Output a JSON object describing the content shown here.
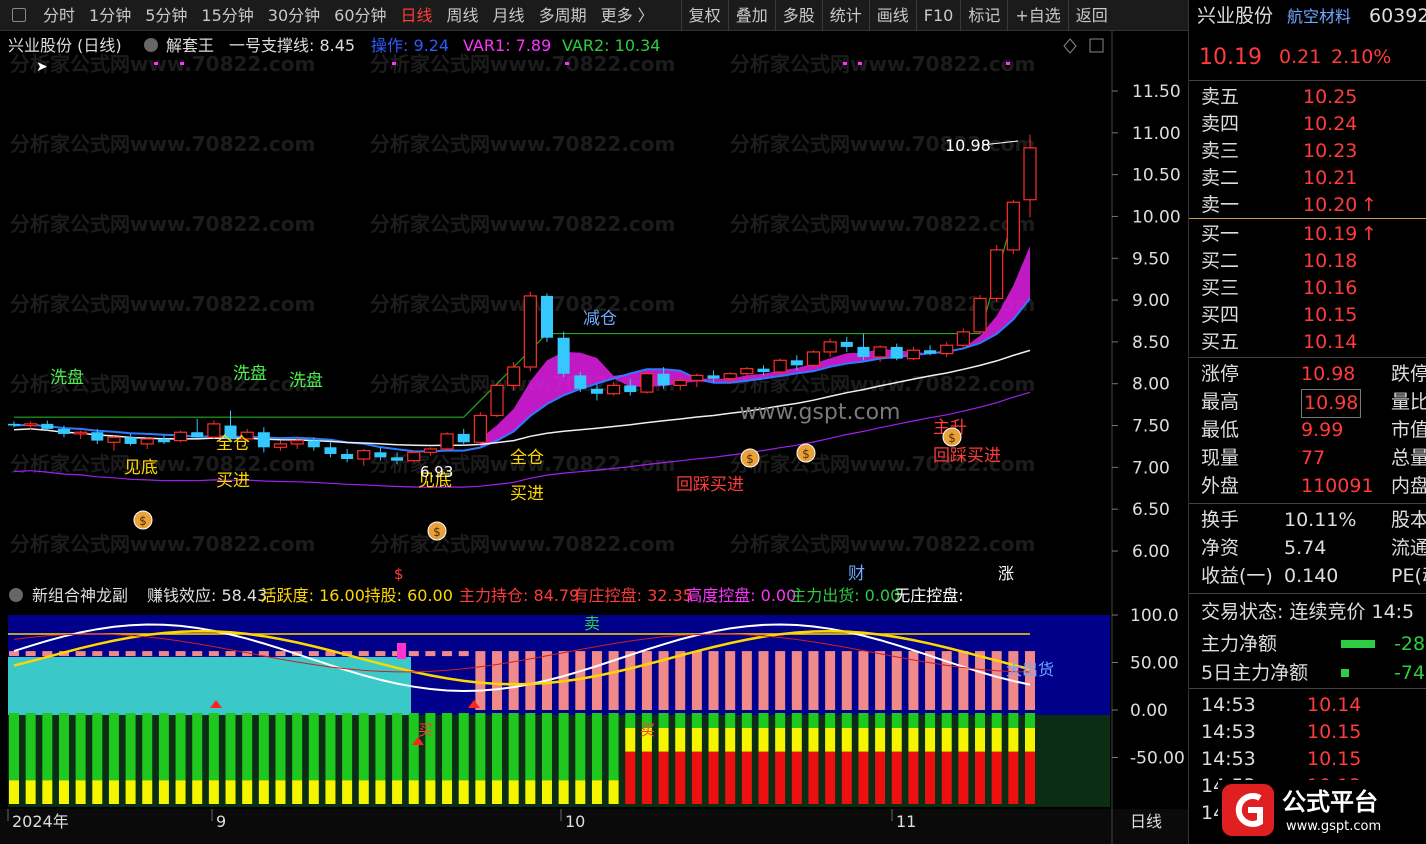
{
  "toolbar": {
    "items": [
      "分时",
      "1分钟",
      "5分钟",
      "15分钟",
      "30分钟",
      "60分钟",
      "日线",
      "周线",
      "月线",
      "多周期",
      "更多 〉"
    ],
    "active_index": 6,
    "right_items": [
      "复权",
      "叠加",
      "多股",
      "统计",
      "画线",
      "F10",
      "标记",
      "+自选",
      "返回"
    ]
  },
  "main_header": {
    "title": "兴业股份 (日线)",
    "indicator": "解套王",
    "support": "一号支撑线: 8.45",
    "op": "操作: 9.24",
    "var1": "VAR1: 7.89",
    "var2": "VAR2: 10.34"
  },
  "sub_header": {
    "name": "新组合神龙副",
    "items": [
      {
        "text": "赚钱效应: 58.43",
        "color": "#e0e0e0"
      },
      {
        "text": "活跃度: 16.00",
        "color": "#ffd700"
      },
      {
        "text": "持股: 60.00",
        "color": "#ffd700"
      },
      {
        "text": "主力持仓: 84.79",
        "color": "#ff3b3b"
      },
      {
        "text": "有庄控盘: 32.35",
        "color": "#ff3b3b"
      },
      {
        "text": "高度控盘: 0.00",
        "color": "#ff33ff"
      },
      {
        "text": "主力出货: 0.00",
        "color": "#2ecc40"
      },
      {
        "text": "无庄控盘:",
        "color": "#ffffff"
      }
    ]
  },
  "chart_data": {
    "type": "candlestick",
    "ylim": [
      6.0,
      11.5
    ],
    "yticks": [
      "11.50",
      "11.00",
      "10.50",
      "10.00",
      "9.50",
      "9.00",
      "8.50",
      "8.00",
      "7.50",
      "7.00",
      "6.50",
      "6.00"
    ],
    "x_labels": [
      "2024年",
      "9",
      "10",
      "11"
    ],
    "period_label": "日线",
    "candles": [
      [
        7.52,
        7.55,
        7.48,
        7.5
      ],
      [
        7.5,
        7.55,
        7.45,
        7.52
      ],
      [
        7.52,
        7.56,
        7.44,
        7.46
      ],
      [
        7.46,
        7.5,
        7.36,
        7.4
      ],
      [
        7.4,
        7.44,
        7.34,
        7.42
      ],
      [
        7.42,
        7.46,
        7.28,
        7.32
      ],
      [
        7.3,
        7.38,
        7.2,
        7.36
      ],
      [
        7.36,
        7.4,
        7.26,
        7.28
      ],
      [
        7.28,
        7.36,
        7.22,
        7.34
      ],
      [
        7.34,
        7.38,
        7.28,
        7.3
      ],
      [
        7.32,
        7.44,
        7.3,
        7.42
      ],
      [
        7.42,
        7.58,
        7.38,
        7.36
      ],
      [
        7.36,
        7.56,
        7.34,
        7.52
      ],
      [
        7.5,
        7.68,
        7.3,
        7.34
      ],
      [
        7.34,
        7.46,
        7.3,
        7.42
      ],
      [
        7.42,
        7.48,
        7.18,
        7.24
      ],
      [
        7.24,
        7.32,
        7.2,
        7.28
      ],
      [
        7.28,
        7.36,
        7.22,
        7.32
      ],
      [
        7.32,
        7.36,
        7.2,
        7.24
      ],
      [
        7.24,
        7.3,
        7.12,
        7.16
      ],
      [
        7.16,
        7.22,
        7.06,
        7.1
      ],
      [
        7.1,
        7.22,
        7.02,
        7.2
      ],
      [
        7.18,
        7.24,
        7.08,
        7.12
      ],
      [
        7.12,
        7.18,
        7.04,
        7.08
      ],
      [
        7.08,
        7.2,
        7.06,
        7.18
      ],
      [
        7.18,
        7.24,
        7.14,
        7.22
      ],
      [
        7.22,
        7.42,
        7.2,
        7.4
      ],
      [
        7.4,
        7.46,
        7.26,
        7.3
      ],
      [
        7.3,
        7.66,
        7.28,
        7.62
      ],
      [
        7.62,
        8.0,
        7.6,
        7.98
      ],
      [
        7.98,
        8.26,
        7.92,
        8.2
      ],
      [
        8.2,
        9.1,
        8.15,
        9.05
      ],
      [
        9.05,
        9.08,
        8.5,
        8.55
      ],
      [
        8.55,
        8.62,
        8.08,
        8.12
      ],
      [
        8.1,
        8.14,
        7.9,
        7.94
      ],
      [
        7.94,
        8.0,
        7.8,
        7.88
      ],
      [
        7.88,
        8.02,
        7.86,
        7.98
      ],
      [
        7.98,
        8.06,
        7.86,
        7.9
      ],
      [
        7.9,
        8.14,
        7.88,
        8.12
      ],
      [
        8.12,
        8.2,
        7.94,
        7.98
      ],
      [
        7.98,
        8.08,
        7.92,
        8.04
      ],
      [
        8.04,
        8.12,
        7.96,
        8.1
      ],
      [
        8.1,
        8.16,
        8.02,
        8.06
      ],
      [
        8.06,
        8.14,
        8.0,
        8.12
      ],
      [
        8.12,
        8.2,
        8.08,
        8.18
      ],
      [
        8.18,
        8.22,
        8.1,
        8.14
      ],
      [
        8.14,
        8.3,
        8.12,
        8.28
      ],
      [
        8.28,
        8.34,
        8.16,
        8.22
      ],
      [
        8.22,
        8.4,
        8.2,
        8.38
      ],
      [
        8.38,
        8.54,
        8.32,
        8.5
      ],
      [
        8.5,
        8.56,
        8.38,
        8.44
      ],
      [
        8.44,
        8.6,
        8.28,
        8.32
      ],
      [
        8.32,
        8.46,
        8.26,
        8.44
      ],
      [
        8.44,
        8.48,
        8.28,
        8.3
      ],
      [
        8.3,
        8.44,
        8.28,
        8.4
      ],
      [
        8.4,
        8.46,
        8.34,
        8.36
      ],
      [
        8.36,
        8.5,
        8.32,
        8.46
      ],
      [
        8.46,
        8.66,
        8.44,
        8.62
      ],
      [
        8.62,
        9.06,
        8.6,
        9.02
      ],
      [
        9.02,
        9.66,
        8.98,
        9.6
      ],
      [
        9.6,
        10.2,
        9.55,
        10.17
      ],
      [
        10.2,
        10.98,
        9.99,
        10.82
      ]
    ],
    "annotations": {
      "high_label": "10.98",
      "low_label": "6.93",
      "jiancang": "减仓",
      "xipan": "洗盘",
      "jiandi": "见底",
      "quancang": "全仓",
      "mairu": "买进",
      "huicai": "回踩买进",
      "zhushou": "主升",
      "cai": "财",
      "zhang": "涨",
      "dollar": "$"
    },
    "sub_chart": {
      "ylim": [
        -100,
        100
      ],
      "yticks": [
        "100.0",
        "50.00",
        "0.00",
        "-50.00"
      ],
      "labels": {
        "sell": "卖",
        "buy": "买",
        "chuhuo": "大出货"
      }
    }
  },
  "right_panel": {
    "stock_name": "兴业股份",
    "stock_tag": "航空材料",
    "stock_code": "60392",
    "price": "10.19",
    "change": "0.21",
    "change_pct": "2.10%",
    "sell": [
      {
        "label": "卖五",
        "price": "10.25"
      },
      {
        "label": "卖四",
        "price": "10.24"
      },
      {
        "label": "卖三",
        "price": "10.23"
      },
      {
        "label": "卖二",
        "price": "10.21"
      },
      {
        "label": "卖一",
        "price": "10.20",
        "arrow": "↑"
      }
    ],
    "buy": [
      {
        "label": "买一",
        "price": "10.19",
        "arrow": "↑"
      },
      {
        "label": "买二",
        "price": "10.18"
      },
      {
        "label": "买三",
        "price": "10.16"
      },
      {
        "label": "买四",
        "price": "10.15"
      },
      {
        "label": "买五",
        "price": "10.14"
      }
    ],
    "stats": [
      {
        "label": "涨停",
        "value": "10.98",
        "extra": "跌停",
        "vcolor": "red"
      },
      {
        "label": "最高",
        "value": "10.98",
        "extra": "量比",
        "vcolor": "red",
        "boxed": true
      },
      {
        "label": "最低",
        "value": "9.99",
        "extra": "市值",
        "vcolor": "red"
      },
      {
        "label": "现量",
        "value": "77",
        "extra": "总量",
        "vcolor": "red"
      },
      {
        "label": "外盘",
        "value": "110091",
        "extra": "内盘",
        "vcolor": "red"
      }
    ],
    "stats2": [
      {
        "label": "换手",
        "value": "10.11%",
        "extra": "股本"
      },
      {
        "label": "净资",
        "value": "5.74",
        "extra": "流通"
      },
      {
        "label": "收益(一)",
        "value": "0.140",
        "extra": "PE(动"
      }
    ],
    "trade_status": "交易状态: 连续竞价 14:5",
    "fund_flow": [
      {
        "label": "主力净额",
        "value": "-28"
      },
      {
        "label": "5日主力净额",
        "value": "-74"
      }
    ],
    "ticks": [
      {
        "time": "14:53",
        "price": "10.14"
      },
      {
        "time": "14:53",
        "price": "10.15"
      },
      {
        "time": "14:53",
        "price": "10.15"
      },
      {
        "time": "14:53",
        "price": "10.13"
      },
      {
        "time": "14:5",
        "price": ""
      }
    ]
  },
  "watermark": "分析家公式网www.70822.com",
  "center_watermark": "www.gspt.com",
  "logo": {
    "title": "公式平台",
    "url": "www.gspt.com"
  }
}
